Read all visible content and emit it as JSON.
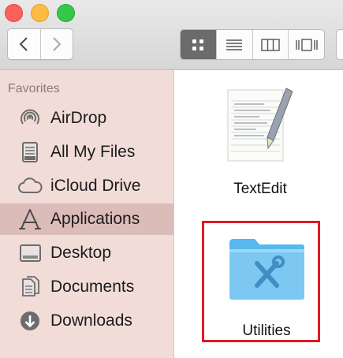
{
  "window": {
    "traffic_lights": [
      {
        "name": "close",
        "color": "#fc605b"
      },
      {
        "name": "minimize",
        "color": "#fdbc40"
      },
      {
        "name": "zoom",
        "color": "#34c84a"
      }
    ]
  },
  "toolbar": {
    "nav": {
      "back_icon": "chevron-left-icon",
      "forward_icon": "chevron-right-icon"
    },
    "view_modes": [
      {
        "icon": "icon-view-icon",
        "active": true
      },
      {
        "icon": "list-view-icon",
        "active": false
      },
      {
        "icon": "column-view-icon",
        "active": false
      },
      {
        "icon": "cover-flow-icon",
        "active": false
      }
    ]
  },
  "sidebar": {
    "heading": "Favorites",
    "selection_color": "#dcbcb8",
    "items": [
      {
        "label": "AirDrop",
        "icon": "airdrop-icon"
      },
      {
        "label": "All My Files",
        "icon": "all-files-icon"
      },
      {
        "label": "iCloud Drive",
        "icon": "cloud-icon"
      },
      {
        "label": "Applications",
        "icon": "applications-icon",
        "selected": true
      },
      {
        "label": "Desktop",
        "icon": "desktop-icon"
      },
      {
        "label": "Documents",
        "icon": "documents-icon"
      },
      {
        "label": "Downloads",
        "icon": "download-icon"
      }
    ]
  },
  "content": {
    "items": [
      {
        "label": "TextEdit",
        "icon": "textedit-icon"
      },
      {
        "label": "Utilities",
        "icon": "utilities-folder-icon",
        "highlighted": true
      }
    ],
    "highlight_color": "#e01a22"
  }
}
